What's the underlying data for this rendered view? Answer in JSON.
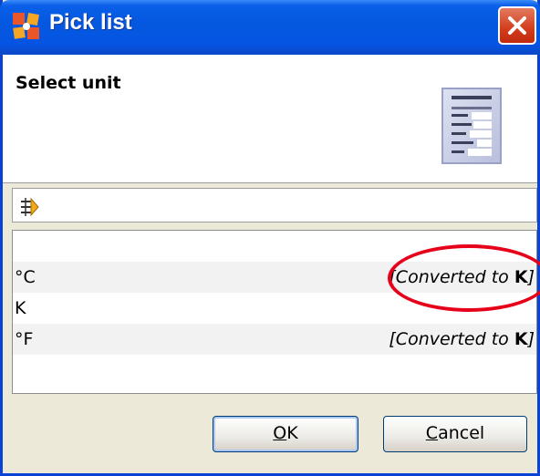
{
  "window": {
    "title": "Pick list"
  },
  "header": {
    "title": "Select unit"
  },
  "icons": {
    "app": "application-logo-icon",
    "close": "close-icon",
    "document": "document-list-icon",
    "filter": "filter-toggle-icon"
  },
  "list": {
    "rows": [
      {
        "unit": "",
        "note_prefix": "",
        "note_unit": ""
      },
      {
        "unit": "°C",
        "note_prefix": "[Converted to ",
        "note_unit": "K",
        "note_suffix": "]"
      },
      {
        "unit": "K",
        "note_prefix": "",
        "note_unit": "",
        "note_suffix": ""
      },
      {
        "unit": "°F",
        "note_prefix": "[Converted to ",
        "note_unit": "K",
        "note_suffix": "]"
      }
    ]
  },
  "buttons": {
    "ok_mnemonic": "O",
    "ok_rest": "K",
    "cancel_mnemonic": "C",
    "cancel_rest": "ancel"
  },
  "colors": {
    "titlebar": "#0458df",
    "highlight_ring": "#e6001a",
    "close_button": "#d33d1b"
  }
}
